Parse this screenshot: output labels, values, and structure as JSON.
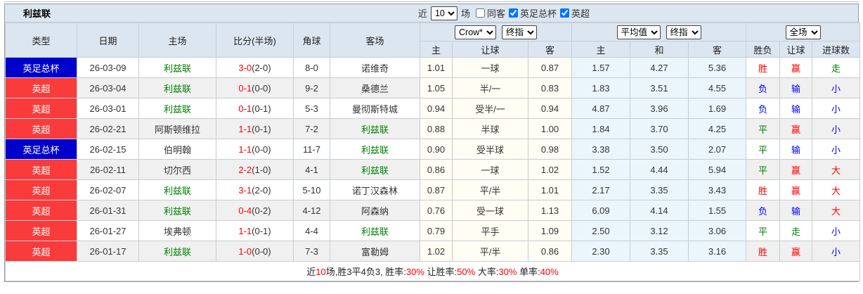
{
  "title_bar": {
    "team": "利兹联",
    "near_label": "近",
    "recent_count": "10",
    "matches_label": "场",
    "filters": [
      {
        "label": "同客",
        "checked": false
      },
      {
        "label": "英足总杯",
        "checked": true
      },
      {
        "label": "英超",
        "checked": true
      }
    ]
  },
  "header": {
    "left_columns": [
      "类型",
      "日期",
      "主场",
      "比分(半场)",
      "角球",
      "客场"
    ],
    "crow_selects": [
      "Crow*",
      "终指"
    ],
    "avg_selects": [
      "平均值",
      "终指"
    ],
    "scope_select": "全场",
    "sub_columns": [
      "主",
      "让球",
      "客",
      "主",
      "和",
      "客",
      "胜负",
      "让球",
      "进球数"
    ]
  },
  "rows": [
    {
      "league": "英足总杯",
      "league_type": "cup",
      "date": "26-03-09",
      "home": "利兹联",
      "home_hl": true,
      "score": "3-0",
      "half": "(2-0)",
      "corners": "8-0",
      "away": "诺维奇",
      "away_hl": false,
      "odds": [
        "1.01",
        "一球",
        "0.87"
      ],
      "avg": [
        "1.57",
        "4.27",
        "5.36"
      ],
      "result": [
        "胜",
        "r"
      ],
      "handicap": [
        "赢",
        "r"
      ],
      "goals": [
        "走",
        "g"
      ]
    },
    {
      "league": "英超",
      "league_type": "epl",
      "date": "26-03-04",
      "home": "利兹联",
      "home_hl": true,
      "score": "0-1",
      "half": "(0-0)",
      "corners": "9-2",
      "away": "桑德兰",
      "away_hl": false,
      "odds": [
        "1.05",
        "半/一",
        "0.83"
      ],
      "avg": [
        "1.83",
        "3.51",
        "4.55"
      ],
      "result": [
        "负",
        "b"
      ],
      "handicap": [
        "输",
        "b"
      ],
      "goals": [
        "小",
        "b"
      ]
    },
    {
      "league": "英超",
      "league_type": "epl",
      "date": "26-03-01",
      "home": "利兹联",
      "home_hl": true,
      "score": "0-1",
      "half": "(0-1)",
      "corners": "5-3",
      "away": "曼彻斯特城",
      "away_hl": false,
      "odds": [
        "0.94",
        "受半/一",
        "0.94"
      ],
      "avg": [
        "4.87",
        "3.96",
        "1.69"
      ],
      "result": [
        "负",
        "b"
      ],
      "handicap": [
        "输",
        "b"
      ],
      "goals": [
        "小",
        "b"
      ]
    },
    {
      "league": "英超",
      "league_type": "epl",
      "date": "26-02-21",
      "home": "阿斯顿维拉",
      "home_hl": false,
      "score": "1-1",
      "half": "(0-1)",
      "corners": "7-2",
      "away": "利兹联",
      "away_hl": true,
      "odds": [
        "0.88",
        "半球",
        "1.00"
      ],
      "avg": [
        "1.84",
        "3.70",
        "4.25"
      ],
      "result": [
        "平",
        "g"
      ],
      "handicap": [
        "赢",
        "r"
      ],
      "goals": [
        "小",
        "b"
      ]
    },
    {
      "league": "英足总杯",
      "league_type": "cup",
      "date": "26-02-15",
      "home": "伯明翰",
      "home_hl": false,
      "score": "1-1",
      "half": "(0-0)",
      "corners": "11-7",
      "away": "利兹联",
      "away_hl": true,
      "odds": [
        "0.90",
        "受半球",
        "0.98"
      ],
      "avg": [
        "3.38",
        "3.50",
        "2.07"
      ],
      "result": [
        "平",
        "g"
      ],
      "handicap": [
        "输",
        "b"
      ],
      "goals": [
        "小",
        "b"
      ]
    },
    {
      "league": "英超",
      "league_type": "epl",
      "date": "26-02-11",
      "home": "切尔西",
      "home_hl": false,
      "score": "2-2",
      "half": "(1-0)",
      "corners": "4-1",
      "away": "利兹联",
      "away_hl": true,
      "odds": [
        "0.86",
        "一球",
        "1.02"
      ],
      "avg": [
        "1.52",
        "4.44",
        "5.94"
      ],
      "result": [
        "平",
        "g"
      ],
      "handicap": [
        "赢",
        "r"
      ],
      "goals": [
        "大",
        "r"
      ]
    },
    {
      "league": "英超",
      "league_type": "epl",
      "date": "26-02-07",
      "home": "利兹联",
      "home_hl": true,
      "score": "3-1",
      "half": "(2-0)",
      "corners": "5-10",
      "away": "诺丁汉森林",
      "away_hl": false,
      "odds": [
        "0.87",
        "平/半",
        "1.01"
      ],
      "avg": [
        "2.17",
        "3.35",
        "3.43"
      ],
      "result": [
        "胜",
        "r"
      ],
      "handicap": [
        "赢",
        "r"
      ],
      "goals": [
        "大",
        "r"
      ]
    },
    {
      "league": "英超",
      "league_type": "epl",
      "date": "26-01-31",
      "home": "利兹联",
      "home_hl": true,
      "score": "0-4",
      "half": "(0-2)",
      "corners": "4-12",
      "away": "阿森纳",
      "away_hl": false,
      "odds": [
        "0.76",
        "受一球",
        "1.13"
      ],
      "avg": [
        "6.09",
        "4.14",
        "1.55"
      ],
      "result": [
        "负",
        "b"
      ],
      "handicap": [
        "输",
        "b"
      ],
      "goals": [
        "大",
        "r"
      ]
    },
    {
      "league": "英超",
      "league_type": "epl",
      "date": "26-01-27",
      "home": "埃弗顿",
      "home_hl": false,
      "score": "1-1",
      "half": "(0-1)",
      "corners": "4-4",
      "away": "利兹联",
      "away_hl": true,
      "odds": [
        "0.79",
        "平手",
        "1.09"
      ],
      "avg": [
        "2.50",
        "3.12",
        "3.06"
      ],
      "result": [
        "平",
        "g"
      ],
      "handicap": [
        "走",
        "g"
      ],
      "goals": [
        "小",
        "b"
      ]
    },
    {
      "league": "英超",
      "league_type": "epl",
      "date": "26-01-17",
      "home": "利兹联",
      "home_hl": true,
      "score": "1-0",
      "half": "(0-0)",
      "corners": "7-3",
      "away": "富勒姆",
      "away_hl": false,
      "odds": [
        "1.02",
        "平/半",
        "0.86"
      ],
      "avg": [
        "2.30",
        "3.35",
        "3.16"
      ],
      "result": [
        "胜",
        "r"
      ],
      "handicap": [
        "赢",
        "r"
      ],
      "goals": [
        "小",
        "b"
      ]
    }
  ],
  "footer": {
    "segments": [
      [
        "近",
        "k"
      ],
      [
        "10",
        "r"
      ],
      [
        "场,胜3平4负3, 胜率:",
        "k"
      ],
      [
        "30%",
        "r"
      ],
      [
        " 让胜率:",
        "k"
      ],
      [
        "50%",
        "r"
      ],
      [
        " 大率:",
        "k"
      ],
      [
        "30%",
        "r"
      ],
      [
        " 单率:",
        "k"
      ],
      [
        "40%",
        "r"
      ]
    ]
  },
  "colors": {
    "cup_badge": "#0000cc",
    "epl_badge": "#f93b3b",
    "team_highlight": "#008000",
    "score_ft": "#ff0000",
    "win": "#ff0000",
    "draw": "#008000",
    "lose": "#0000ff",
    "header_bg": "#dce6f0",
    "odds_bg": "#fffdf4",
    "avg_bg": "#ebf6fc"
  }
}
